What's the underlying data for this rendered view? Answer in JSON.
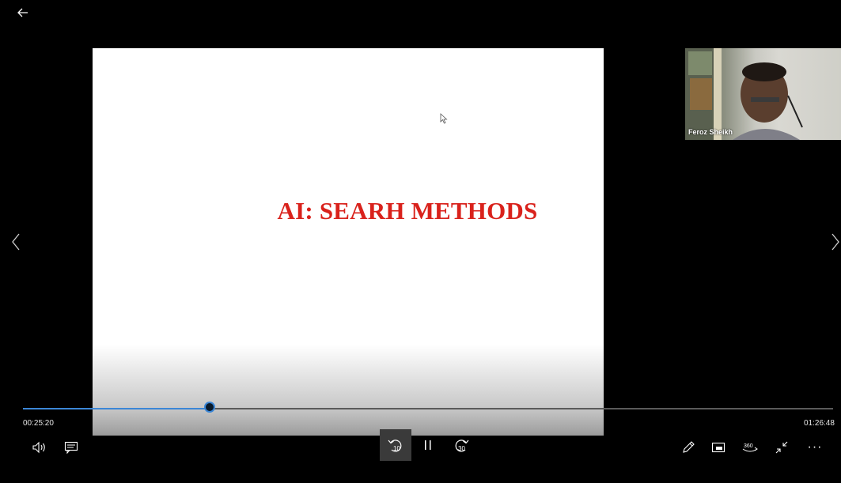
{
  "slide": {
    "title": "AI: SEARH METHODS"
  },
  "webcam": {
    "participant_name": "Feroz Sheikh"
  },
  "player": {
    "elapsed": "00:25:20",
    "total": "01:26:48",
    "progress_fraction": 0.23,
    "skip_back_seconds": "10",
    "skip_forward_seconds": "30",
    "more_label": "···"
  },
  "icons": {
    "back": "back-arrow-icon",
    "prev": "chevron-left-icon",
    "next": "chevron-right-icon",
    "volume": "volume-icon",
    "subtitles": "subtitles-icon",
    "rewind": "skip-back-10-icon",
    "pause": "pause-icon",
    "forward": "skip-forward-30-icon",
    "pen": "pen-icon",
    "mini_view": "mini-view-icon",
    "vr": "360-view-icon",
    "shrink": "exit-fullscreen-icon"
  },
  "colors": {
    "accent": "#3b86d6",
    "title_red": "#d9221c",
    "background": "#000000"
  }
}
